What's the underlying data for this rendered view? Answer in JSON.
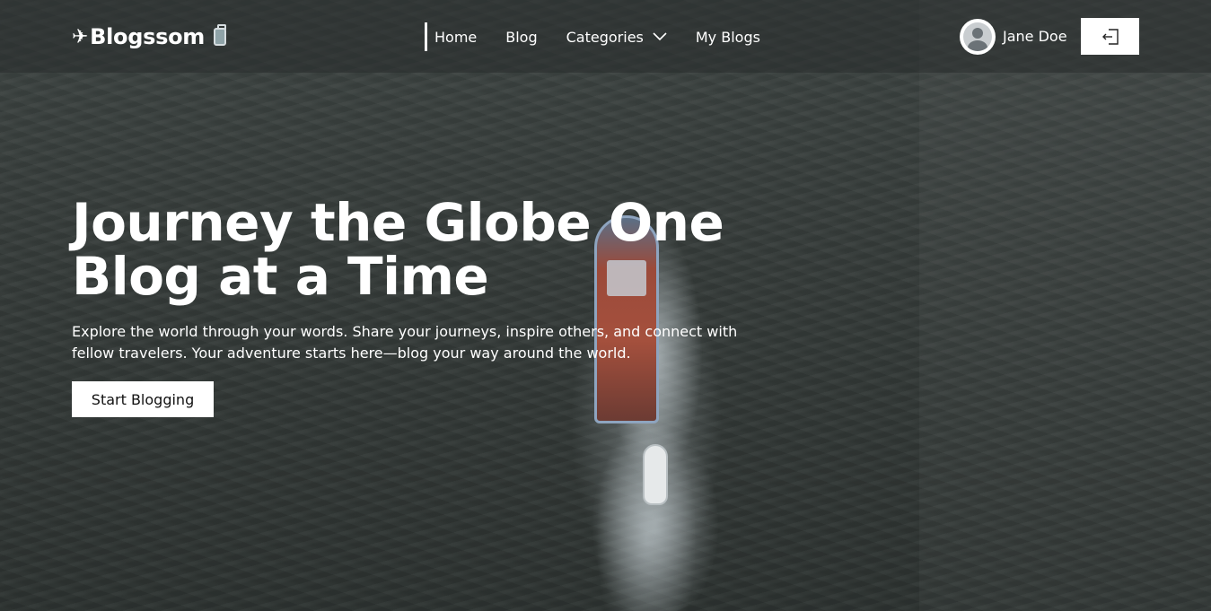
{
  "header": {
    "brand": "Blogssom",
    "nav": [
      {
        "label": "Home",
        "active": true
      },
      {
        "label": "Blog"
      },
      {
        "label": "Categories",
        "has_dropdown": true
      },
      {
        "label": "My Blogs"
      }
    ],
    "user": {
      "name": "Jane Doe"
    },
    "icons": {
      "brand_prefix": "airplane-icon",
      "brand_suffix": "luggage-icon",
      "dropdown": "chevron-down-icon",
      "logout": "logout-icon"
    }
  },
  "hero": {
    "title": "Journey the Globe One Blog at a Time",
    "description": "Explore the world through your words. Share your journeys, inspire others, and connect with fellow travelers. Your adventure starts here—blog your way around the world.",
    "cta_label": "Start Blogging"
  },
  "colors": {
    "header_bg": "#282c2b",
    "text": "#ffffff",
    "button_bg": "#ffffff",
    "button_text": "#111111"
  }
}
